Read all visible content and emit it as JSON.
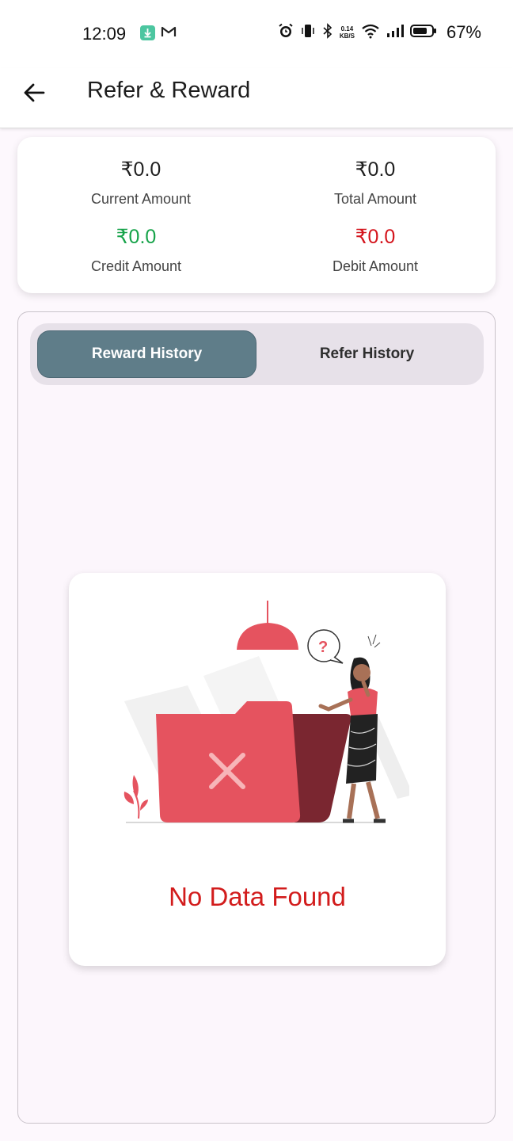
{
  "status_bar": {
    "time": "12:09",
    "net_speed_value": "0.14",
    "net_speed_unit": "KB/S",
    "battery": "67%",
    "icons": [
      "download-icon",
      "gmail-icon",
      "alarm-icon",
      "vibrate-icon",
      "bluetooth-icon",
      "wifi-icon",
      "signal-icon",
      "battery-icon"
    ]
  },
  "app_bar": {
    "title": "Refer & Reward",
    "back_icon": "arrow-left-icon"
  },
  "summary": {
    "current": {
      "value": "₹0.0",
      "label": "Current Amount"
    },
    "total": {
      "value": "₹0.0",
      "label": "Total Amount"
    },
    "credit": {
      "value": "₹0.0",
      "label": "Credit Amount"
    },
    "debit": {
      "value": "₹0.0",
      "label": "Debit Amount"
    }
  },
  "tabs": {
    "reward": "Reward History",
    "refer": "Refer History",
    "selected": "Reward History"
  },
  "empty_state": {
    "message": "No Data Found",
    "illustration": "empty-folder-illustration"
  },
  "colors": {
    "credit": "#17a34a",
    "debit": "#d4141c",
    "tab_active": "#5f7d89",
    "empty_text": "#d21c1c"
  }
}
